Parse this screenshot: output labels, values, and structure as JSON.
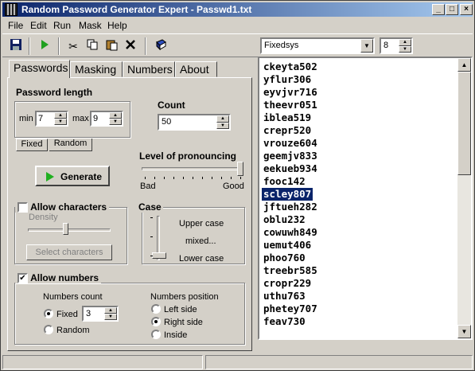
{
  "window": {
    "title": "Random Password Generator Expert - Passwd1.txt"
  },
  "menu": [
    "File",
    "Edit",
    "Run",
    "Mask",
    "Help"
  ],
  "toolbar": {
    "font_name": "Fixedsys",
    "font_size": "8"
  },
  "tabs": [
    "Passwords",
    "Masking",
    "Numbers",
    "About"
  ],
  "length": {
    "title": "Password length",
    "min_label": "min",
    "min_value": "7",
    "max_label": "max",
    "max_value": "9",
    "fixed_label": "Fixed",
    "random_label": "Random"
  },
  "count": {
    "label": "Count",
    "value": "50"
  },
  "generate_label": "Generate",
  "pronouncing": {
    "label": "Level of pronouncing",
    "bad": "Bad",
    "good": "Good",
    "level": 1.0
  },
  "allow_chars": {
    "label": "Allow characters",
    "checked": false,
    "density_label": "Density",
    "select_label": "Select characters"
  },
  "case": {
    "title": "Case",
    "upper": "Upper case",
    "mixed": "mixed...",
    "lower": "Lower case"
  },
  "allow_numbers": {
    "label": "Allow numbers",
    "checked": true,
    "count_title": "Numbers count",
    "fixed": "Fixed",
    "fixed_value": "3",
    "random": "Random",
    "position_title": "Numbers position",
    "left": "Left side",
    "right": "Right side",
    "inside": "Inside"
  },
  "passwords": [
    "ckeyta502",
    "yflur306",
    "eyvjvr716",
    "theevr051",
    "iblea519",
    "crepr520",
    "vrouze604",
    "geemjv833",
    "eekueb934",
    "fooc142",
    "scley807",
    "jftueh282",
    "oblu232",
    "cowuwh849",
    "uemut406",
    "phoo760",
    "treebr585",
    "cropr229",
    "uthu763",
    "phetey707",
    "feav730"
  ],
  "selected_index": 10
}
